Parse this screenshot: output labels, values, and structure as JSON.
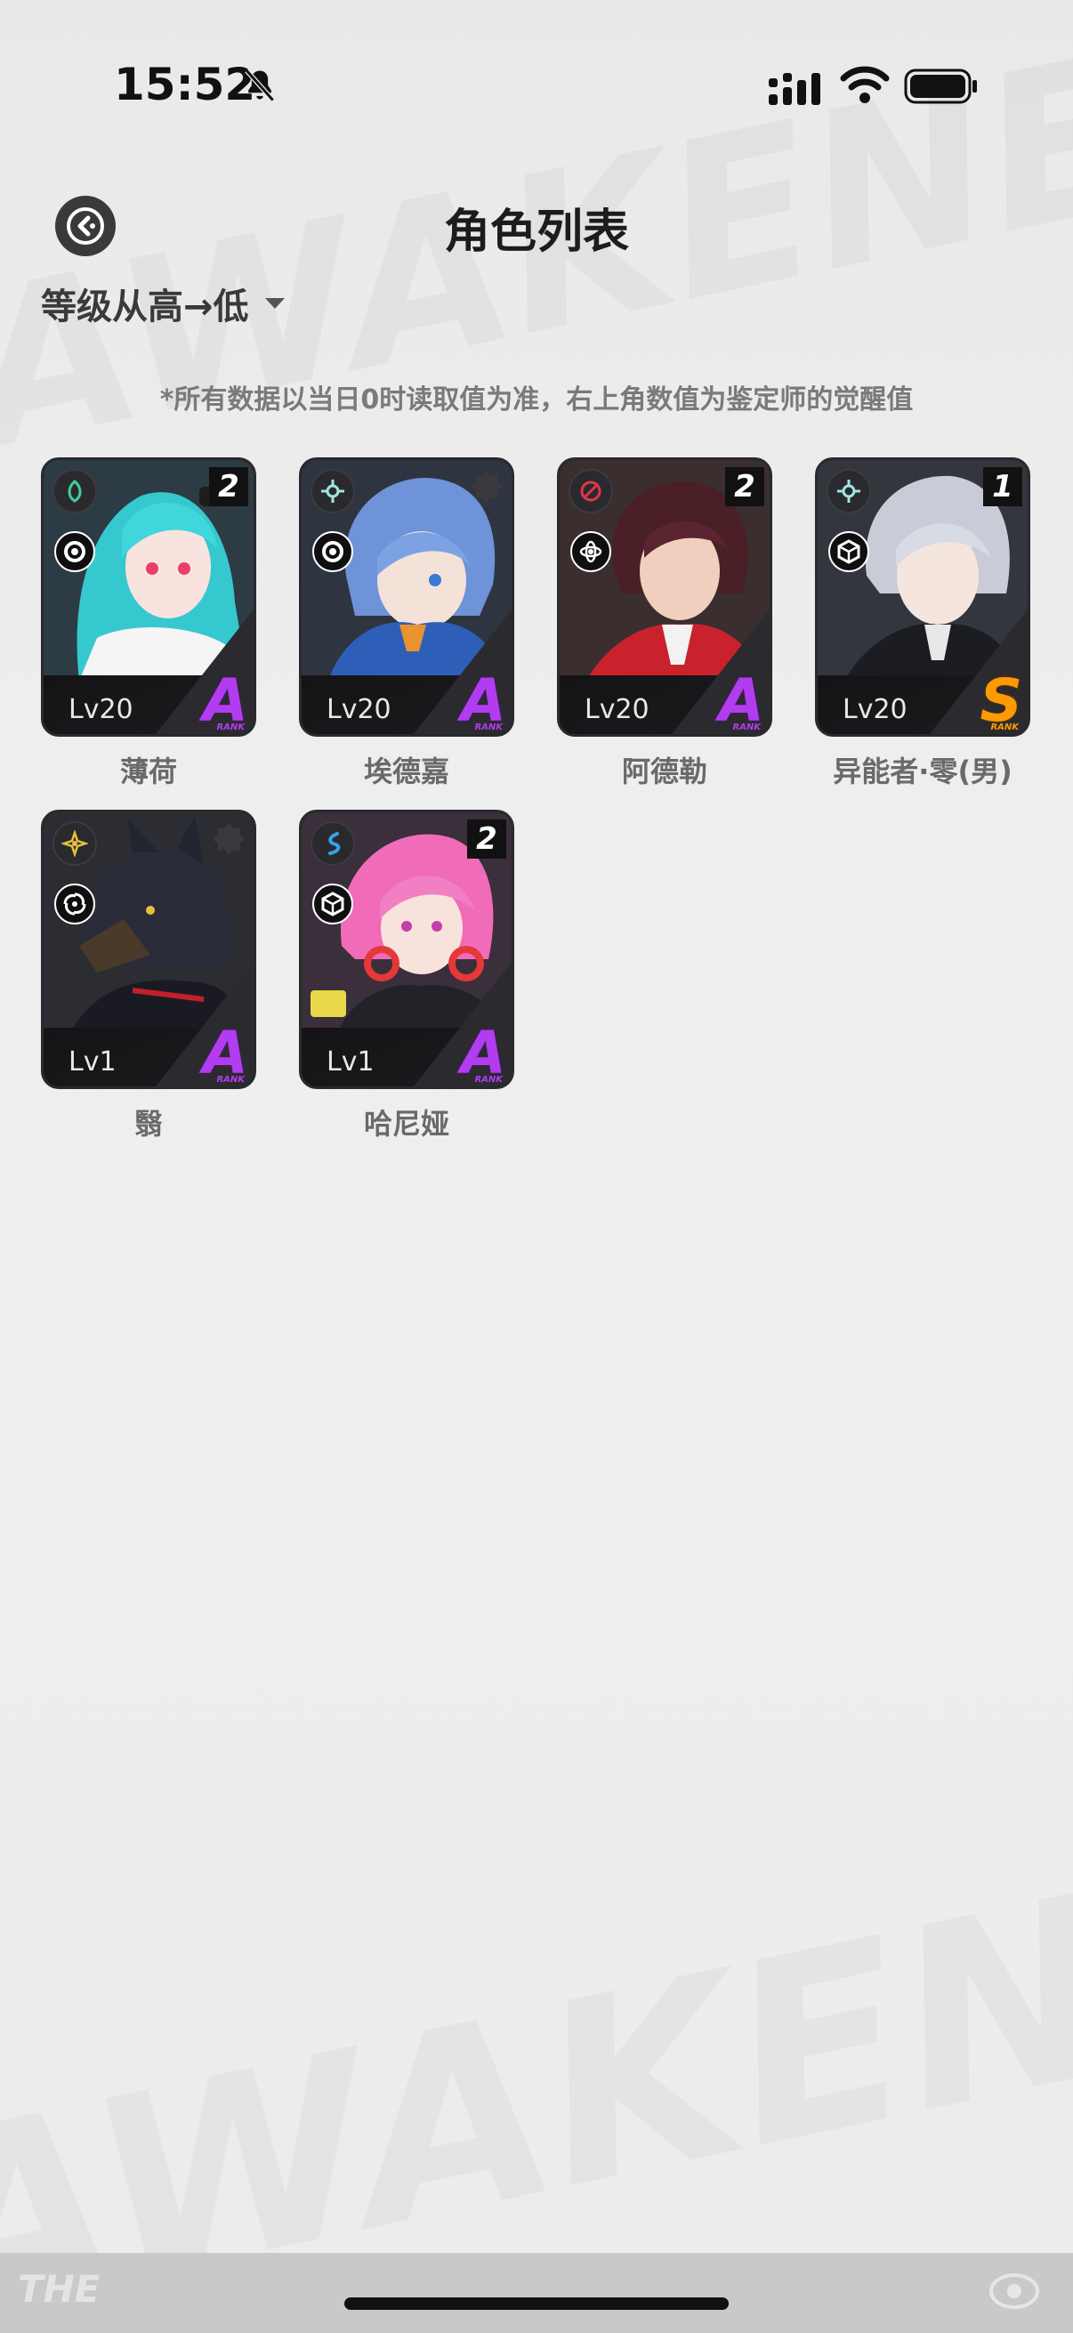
{
  "status_bar": {
    "time": "15:52"
  },
  "header": {
    "title": "角色列表"
  },
  "sort": {
    "label": "等级从高→低"
  },
  "notice": "*所有数据以当日0时读取值为准，右上角数值为鉴定师的觉醒值",
  "characters": [
    {
      "name": "薄荷",
      "level": "Lv20",
      "rank": "A",
      "awakening": "2",
      "attr_color": "#3ecf9b",
      "rank_word": "RANK"
    },
    {
      "name": "埃德嘉",
      "level": "Lv20",
      "rank": "A",
      "awakening": "",
      "attr_color": "#9fe6e0",
      "rank_word": "RANK"
    },
    {
      "name": "阿德勒",
      "level": "Lv20",
      "rank": "A",
      "awakening": "2",
      "attr_color": "#e0374a",
      "rank_word": "RANK"
    },
    {
      "name": "异能者·零(男)",
      "level": "Lv20",
      "rank": "S",
      "awakening": "1",
      "attr_color": "#9fe6e0",
      "rank_word": "RANK"
    },
    {
      "name": "翳",
      "level": "Lv1",
      "rank": "A",
      "awakening": "",
      "attr_color": "#e6c23a",
      "rank_word": "RANK"
    },
    {
      "name": "哈尼娅",
      "level": "Lv1",
      "rank": "A",
      "awakening": "2",
      "attr_color": "#3aa2e6",
      "rank_word": "RANK"
    }
  ],
  "footer": {
    "logo": "THE"
  }
}
